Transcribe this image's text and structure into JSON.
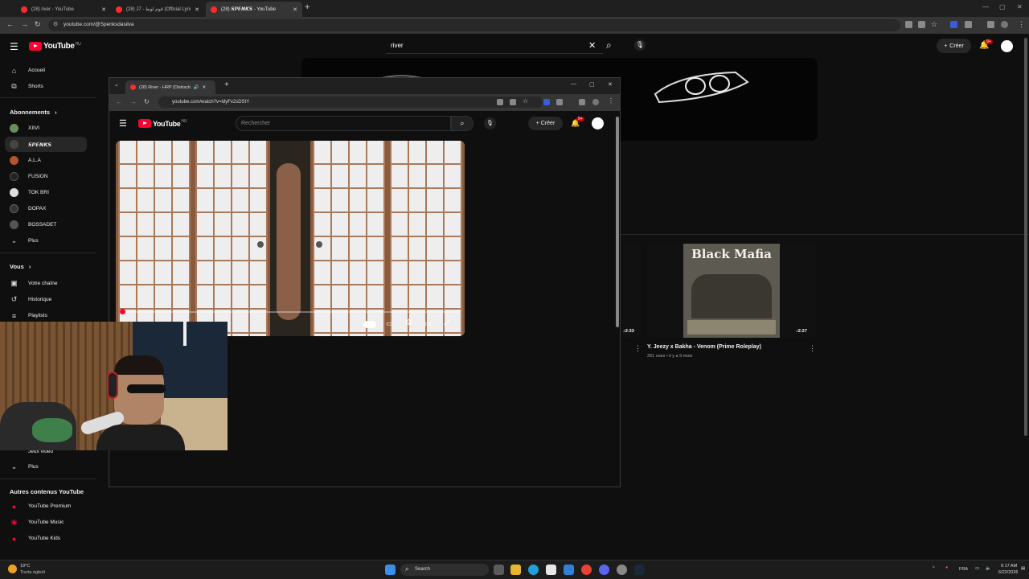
{
  "browser": {
    "tabs": [
      {
        "label": "(28) river - YouTube"
      },
      {
        "label": "(28) J7 - قوم لوط (Official Lyric"
      },
      {
        "label": "(28) 𝙎𝙋𝙀𝙉𝙆𝙎 - YouTube"
      }
    ],
    "url": "youtube.com/@Spenksdasilva"
  },
  "youtube": {
    "logo_text": "YouTube",
    "region": "HU",
    "search_value": "river",
    "create_label": "Créer",
    "notif_count": "9+"
  },
  "sidebar": {
    "main": [
      {
        "label": "Accueil",
        "icon": "home-icon"
      },
      {
        "label": "Shorts",
        "icon": "shorts-icon"
      }
    ],
    "subs_heading": "Abonnements",
    "subs": [
      {
        "label": "XIIVI",
        "color": "#6a8f5a"
      },
      {
        "label": "𝙎𝙋𝙀𝙉𝙆𝙎",
        "color": "#444444"
      },
      {
        "label": "A.L.A",
        "color": "#b5532b"
      },
      {
        "label": "FUSION",
        "color": "#222222"
      },
      {
        "label": "TOK BRI",
        "color": "#dddddd"
      },
      {
        "label": "DOPAX",
        "color": "#333333"
      },
      {
        "label": "BOSSADET",
        "color": "#555555"
      }
    ],
    "subs_more": "Plus",
    "you_heading": "Vous",
    "you": [
      {
        "label": "Votre chaîne",
        "icon": "channel-icon"
      },
      {
        "label": "Historique",
        "icon": "history-icon"
      },
      {
        "label": "Playlists",
        "icon": "playlists-icon"
      }
    ],
    "explore_partial": "Jeux vidéo",
    "explore_more": "Plus",
    "other_heading": "Autres contenus YouTube",
    "other": [
      {
        "label": "YouTube Premium"
      },
      {
        "label": "YouTube Music"
      },
      {
        "label": "YouTube Kids"
      }
    ]
  },
  "channel_videos": [
    {
      "duration": "2:33"
    },
    {
      "title": "Y. Jeezy x Bakha - Venom (Prime Roleplay)",
      "meta": "261 vues • il y a 9 mois",
      "duration": "2:27",
      "thumb_text": "Black Mafia"
    }
  ],
  "popup": {
    "tab_title": "(28) River - HRP (Distracti",
    "url": "youtube.com/watch?v=ldyFv2sDSIY",
    "search_placeholder": "Rechercher",
    "create_label": "Créer",
    "notif_count": "9+",
    "region": "HU"
  },
  "taskbar": {
    "weather_temp": "19°C",
    "weather_desc": "Tiszta égbolt",
    "search_label": "Search",
    "lang": "FRA",
    "time": "6:17 AM",
    "date": "6/22/2026"
  },
  "colors": {
    "accent": "#ff0033",
    "bg": "#0f0f0f"
  }
}
